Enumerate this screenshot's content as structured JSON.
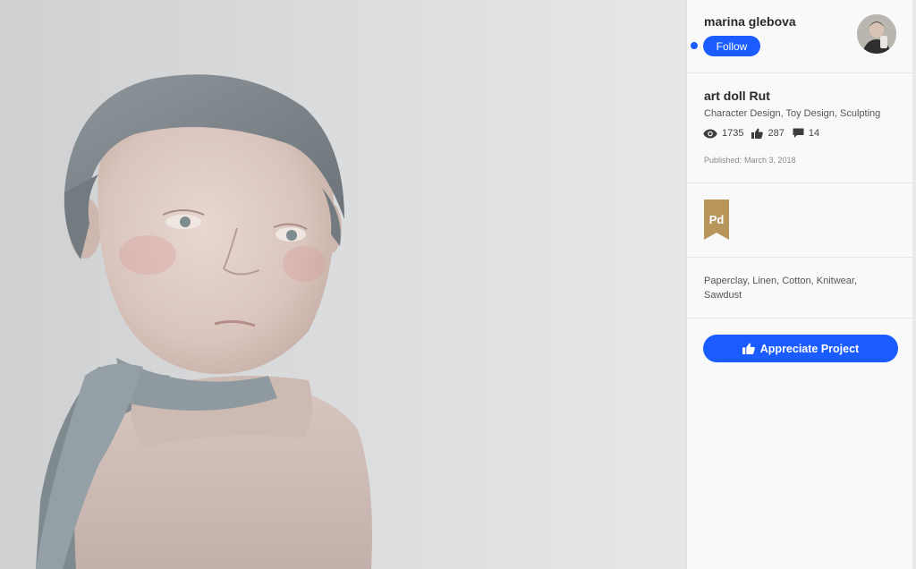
{
  "owner": {
    "name": "marina glebova",
    "follow_label": "Follow"
  },
  "project": {
    "title": "art doll Rut",
    "fields": "Character Design, Toy Design, Sculpting",
    "stats": {
      "views": "1735",
      "appreciations": "287",
      "comments": "14"
    },
    "published_label": "Published:",
    "published_date": "March 3, 2018"
  },
  "tools": [
    {
      "label": "Pd",
      "color": "#b8955a"
    }
  ],
  "materials": "Paperclay, Linen, Cotton, Knitwear, Sawdust",
  "appreciate_label": "Appreciate Project",
  "colors": {
    "accent": "#1a5cff",
    "panel_bg": "#f9f9f9"
  },
  "icons": {
    "views": "eye-icon",
    "appreciations": "thumbs-up-icon",
    "comments": "comment-icon"
  }
}
